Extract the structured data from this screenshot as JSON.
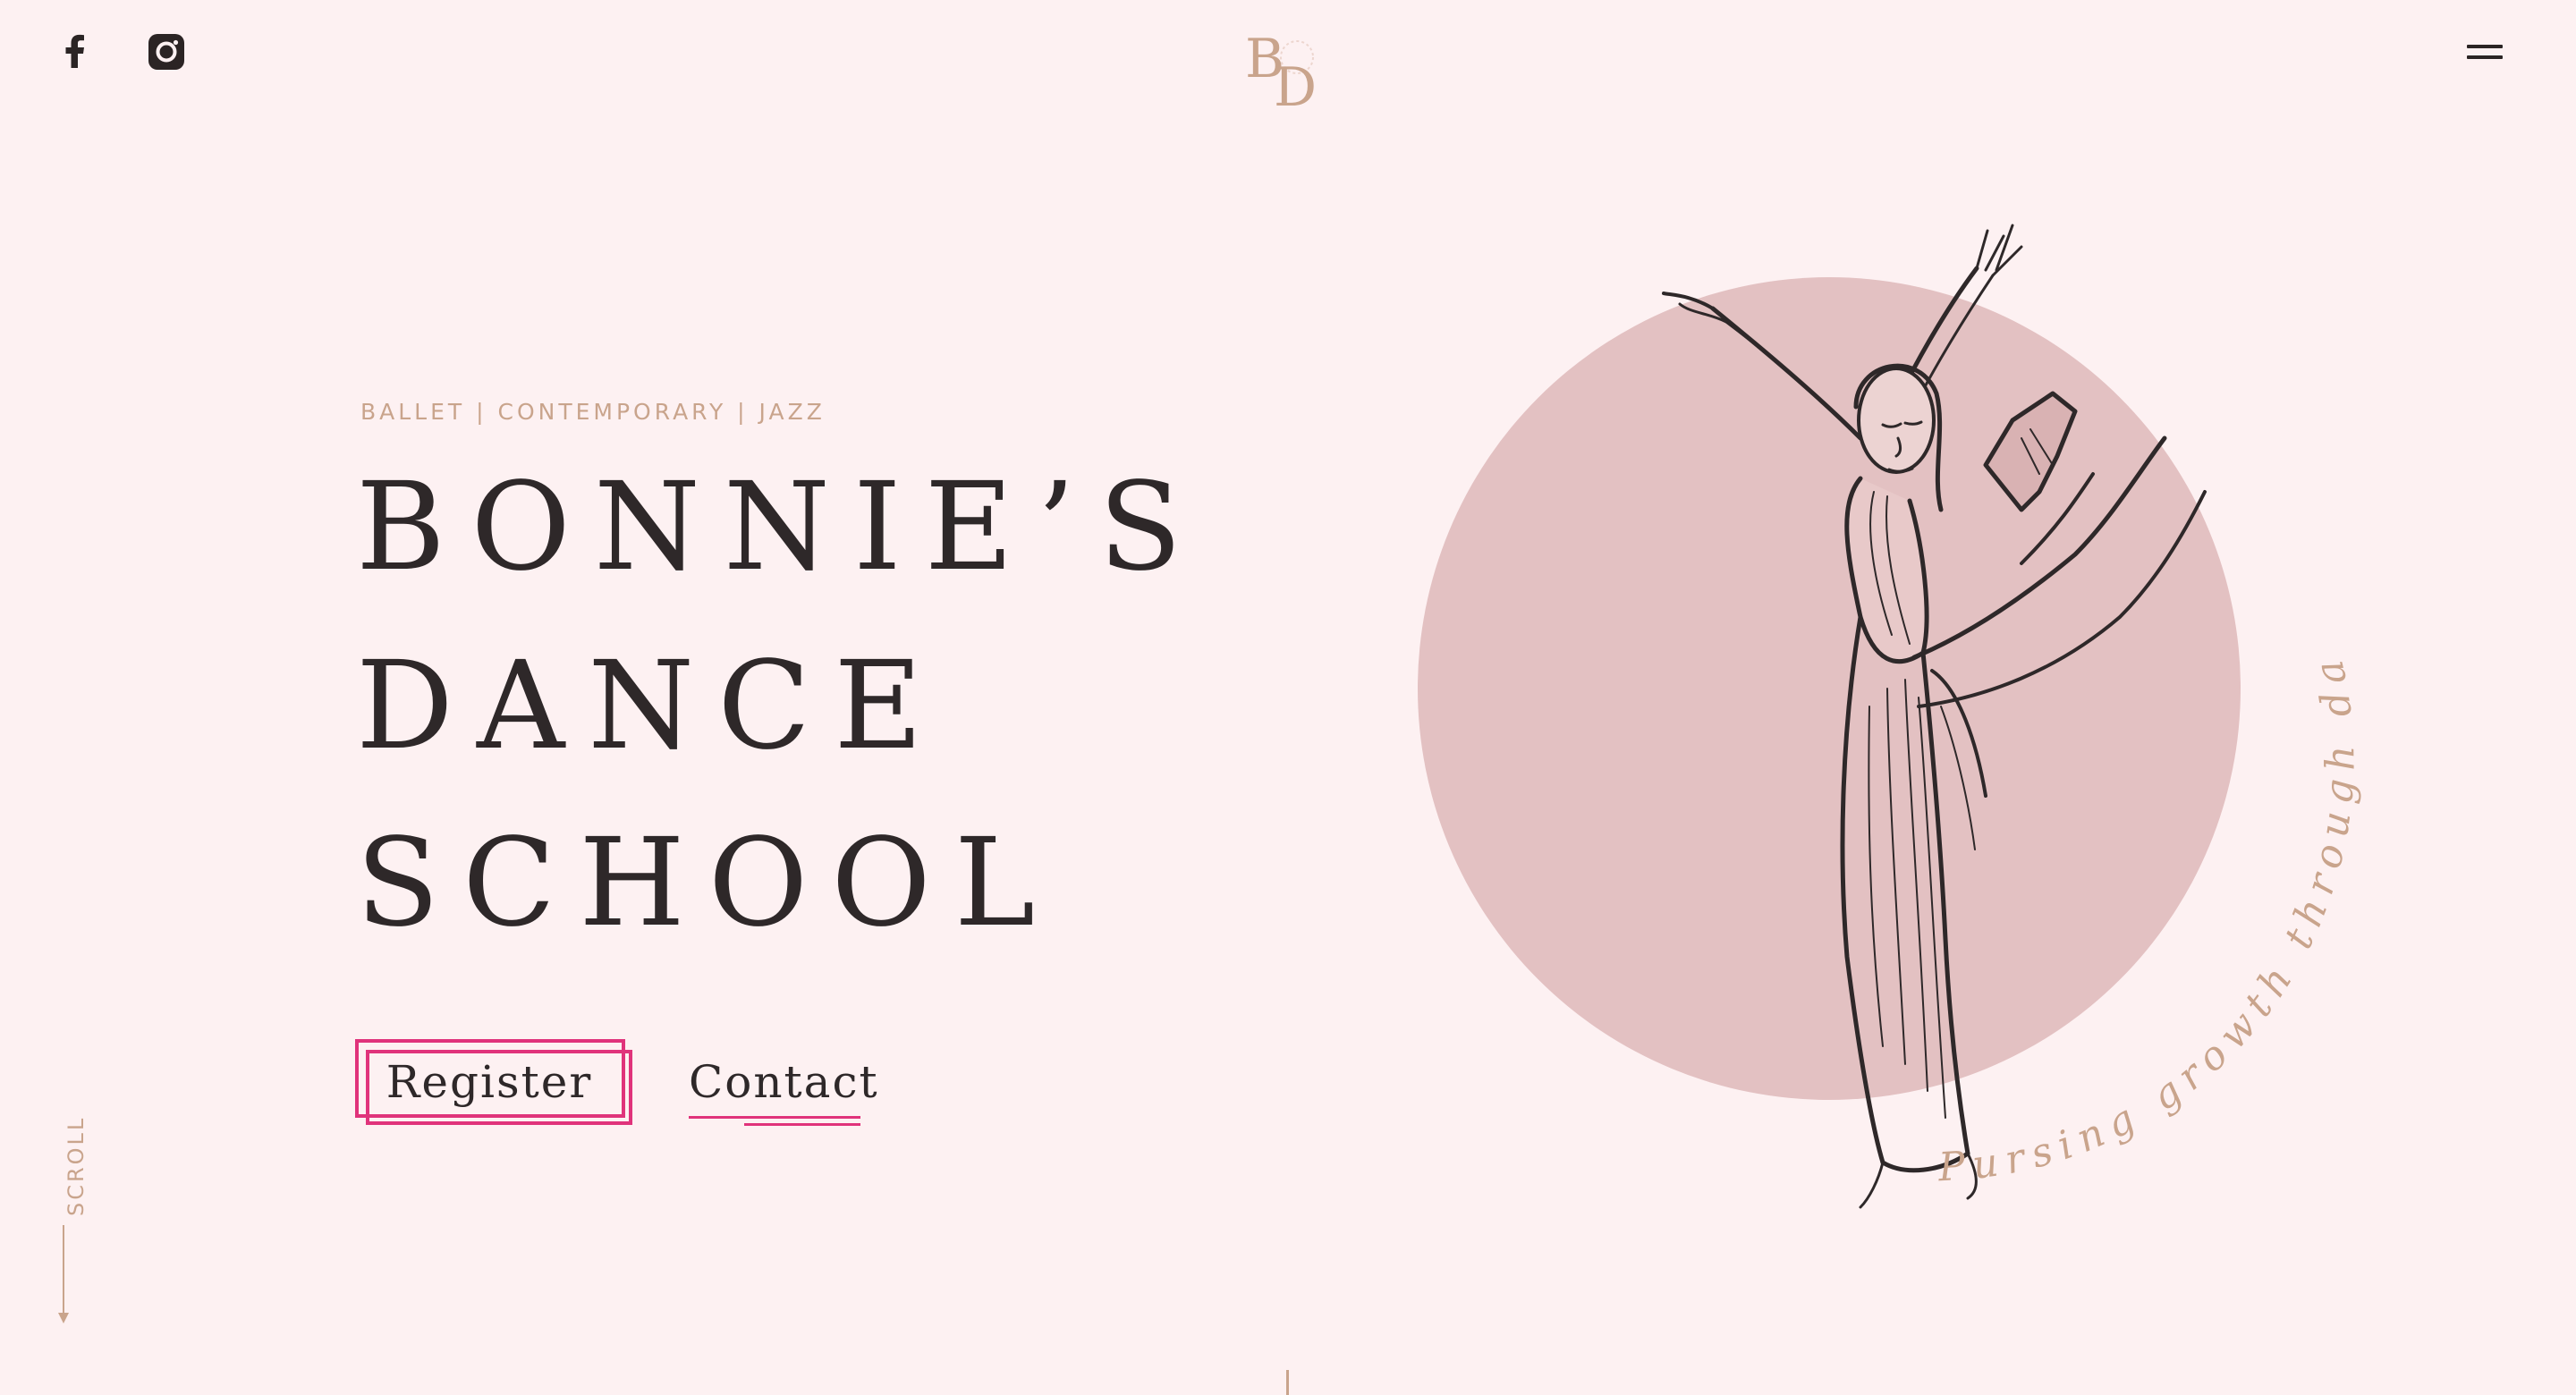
{
  "header": {
    "social": [
      {
        "name": "facebook",
        "icon": "facebook-icon"
      },
      {
        "name": "instagram",
        "icon": "instagram-icon"
      }
    ],
    "logo": {
      "letters": [
        "B",
        "D"
      ],
      "color": "#c9a48c"
    },
    "menu_icon": "hamburger-icon"
  },
  "hero": {
    "tagline": "BALLET | CONTEMPORARY | JAZZ",
    "title_lines": [
      "BONNIE’S",
      "DANCE",
      "SCHOOL"
    ],
    "buttons": {
      "register": "Register",
      "contact": "Contact"
    },
    "illustration": {
      "circle_color": "#e3c1c2",
      "curved_text": "Pursing growth through dance",
      "curved_text_color": "#c9a48c"
    }
  },
  "scroll_indicator": {
    "label": "SCROLL"
  },
  "colors": {
    "background": "#fdf1f2",
    "text": "#2e2829",
    "accent": "#e0337b",
    "gold": "#c9a48c"
  }
}
